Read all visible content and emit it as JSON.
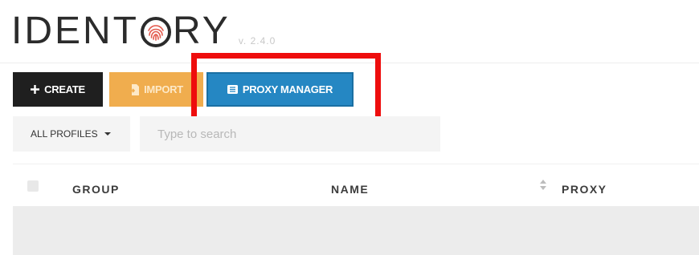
{
  "app": {
    "logo_text_left": "IDENT",
    "logo_text_right": "RY",
    "version": "v. 2.4.0"
  },
  "toolbar": {
    "create_label": "CREATE",
    "import_label": "IMPORT",
    "proxy_manager_label": "PROXY MANAGER"
  },
  "filters": {
    "profile_filter_label": "ALL PROFILES",
    "search_placeholder": "Type to search",
    "search_value": ""
  },
  "table": {
    "columns": [
      "GROUP",
      "NAME",
      "PROXY"
    ]
  },
  "colors": {
    "create": "#1f1f1f",
    "import": "#f0ad4e",
    "proxy_manager": "#2587c3",
    "highlight": "#ee0d0d"
  },
  "icons": {
    "logo_o": "fingerprint-icon",
    "create": "plus-icon",
    "import": "file-import-icon",
    "proxy_manager": "list-icon",
    "filter": "caret-down-icon",
    "sort": "sort-icon"
  }
}
